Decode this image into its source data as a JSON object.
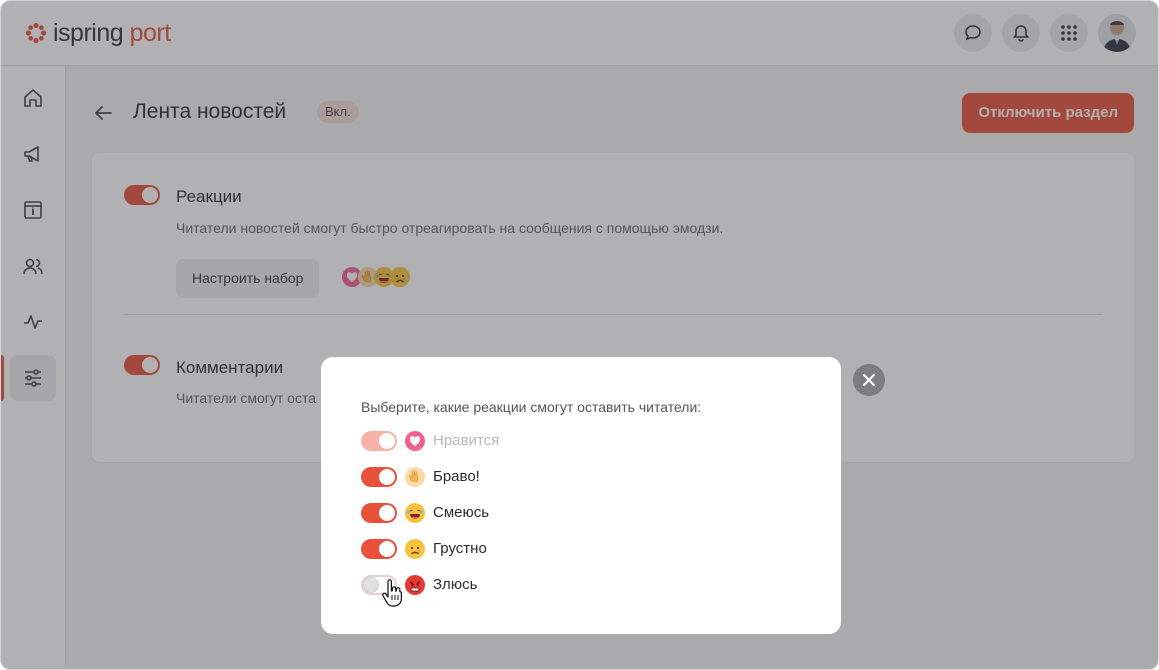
{
  "app": {
    "logo_main": "ispring",
    "logo_accent": "port"
  },
  "header": {
    "icons": [
      "chat-icon",
      "bell-icon",
      "apps-grid-icon"
    ],
    "avatar": "user-avatar"
  },
  "sidebar": {
    "items": [
      "home-icon",
      "megaphone-icon",
      "info-board-icon",
      "users-icon",
      "activity-icon",
      "settings-sliders-icon"
    ],
    "active_index": 5
  },
  "page": {
    "title": "Лента новостей",
    "status_badge": "Вкл.",
    "disable_button": "Отключить раздел"
  },
  "reactions_section": {
    "title": "Реакции",
    "description": "Читатели новостей смогут быстро отреагировать на сообщения с помощью эмодзи.",
    "setup_button": "Настроить набор",
    "enabled": true
  },
  "comments_section": {
    "title": "Комментарии",
    "description_visible": "Читатели смогут оста",
    "enabled": true
  },
  "modal": {
    "prompt": "Выберите, какие реакции смогут оставить читатели:",
    "reactions": [
      {
        "label": "Нравится",
        "enabled": true,
        "disabled": true,
        "emoji": "heart-emoji"
      },
      {
        "label": "Браво!",
        "enabled": true,
        "disabled": false,
        "emoji": "clap-emoji"
      },
      {
        "label": "Смеюсь",
        "enabled": true,
        "disabled": false,
        "emoji": "laugh-emoji"
      },
      {
        "label": "Грустно",
        "enabled": true,
        "disabled": false,
        "emoji": "sad-emoji"
      },
      {
        "label": "Злюсь",
        "enabled": false,
        "disabled": false,
        "emoji": "angry-emoji"
      }
    ]
  },
  "colors": {
    "accent": "#e8503a",
    "badge_bg": "#f6dcd8"
  }
}
